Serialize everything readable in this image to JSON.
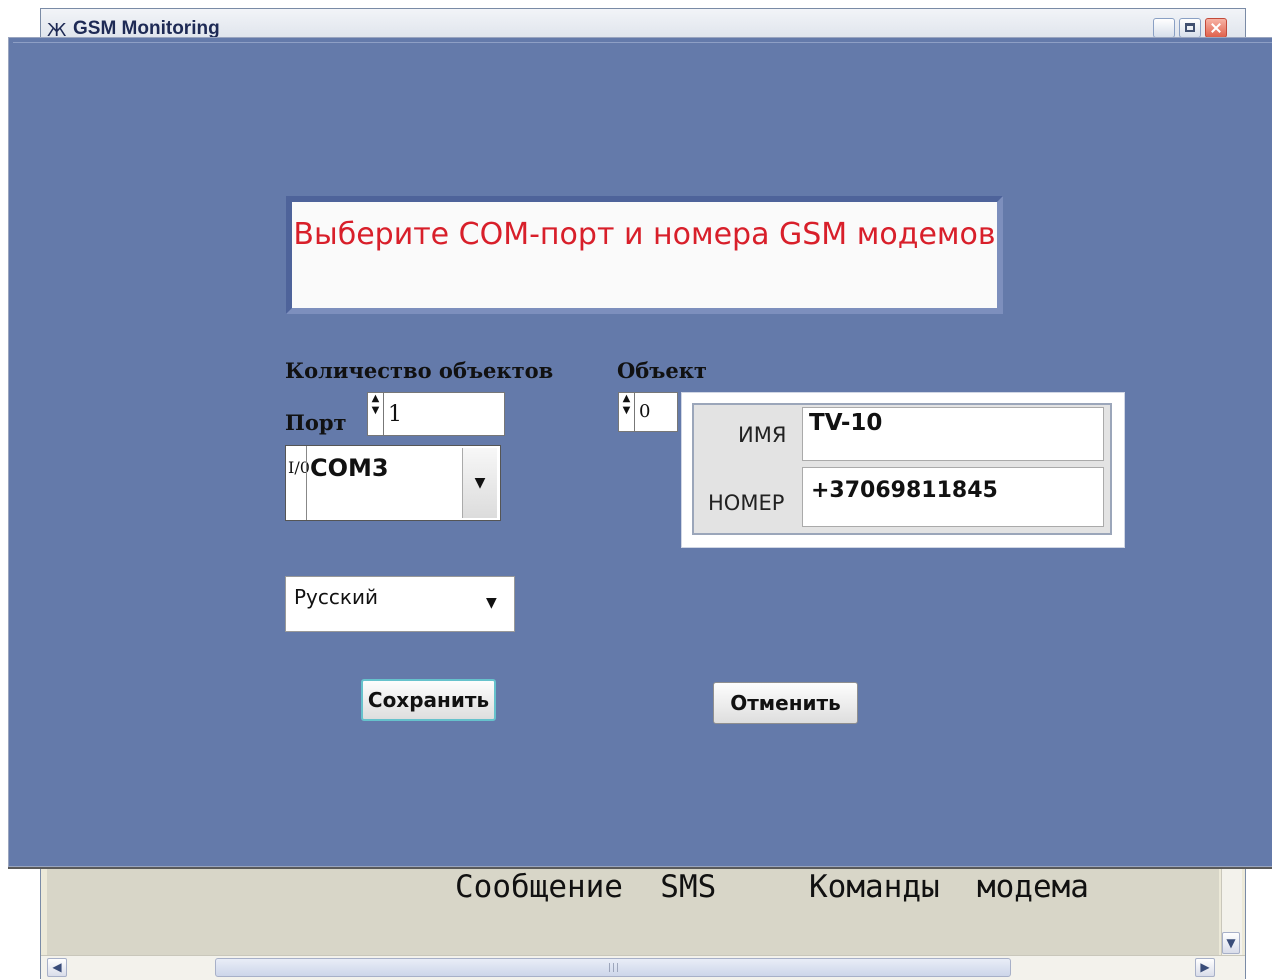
{
  "back_window": {
    "app_icon": "Ж",
    "title": "GSM Monitoring",
    "tabs": [
      {
        "label": "Сообщение  SMS"
      },
      {
        "label": "Команды  модема"
      }
    ],
    "scroll_grip": "|||"
  },
  "dialog": {
    "banner_text": "Выберите COM-порт и номера GSM модемов",
    "count_label": "Количество объектов",
    "count_value": "1",
    "port_label": "Порт",
    "port_io_icon": "I/0",
    "port_value": "COM3",
    "object_label": "Объект",
    "object_index": "0",
    "name_label": "ИМЯ",
    "name_value": "TV-10",
    "number_label": "НОМЕР",
    "number_value": "+37069811845",
    "language_value": "Русский",
    "save_label": "Сохранить",
    "cancel_label": "Отменить"
  },
  "icons": {
    "spinner": "spin-up-down-icon",
    "dropdown": "dropdown-arrow-icon",
    "io": "io-icon"
  },
  "colors": {
    "dialog_bg": "#647aaa",
    "banner_text": "#d81f2a",
    "save_focus": "#66c2cc"
  }
}
